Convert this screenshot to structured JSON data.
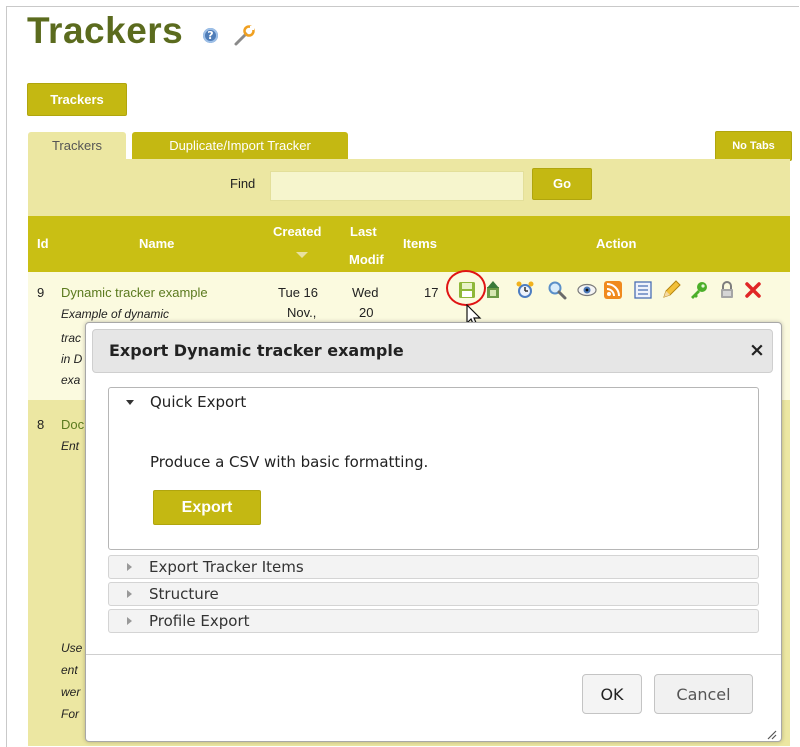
{
  "page": {
    "title": "Trackers",
    "help_icon": "help-icon",
    "admin_icon": "wrench-icon",
    "trackers_button": "Trackers",
    "no_tabs_button": "No Tabs"
  },
  "tabs": [
    {
      "label": "Trackers",
      "active": true
    },
    {
      "label": "Duplicate/Import Tracker",
      "active": false
    }
  ],
  "find": {
    "label": "Find",
    "value": "",
    "button": "Go"
  },
  "table": {
    "headers": {
      "id": "Id",
      "name": "Name",
      "created": "Created",
      "last_modif_line1": "Last",
      "last_modif_line2": "Modif",
      "items": "Items",
      "action": "Action"
    },
    "rows": [
      {
        "id": "9",
        "name": "Dynamic tracker example",
        "description_line1": "Example of dynamic",
        "description_partial": [
          "trac",
          "in D",
          "exa"
        ],
        "created_line1": "Tue 16",
        "created_line2": "Nov.,",
        "modified_line1": "Wed",
        "modified_line2": "20",
        "items": "17"
      },
      {
        "id": "8",
        "name_partial": "Doc",
        "description_partial": [
          "Ent",
          "Use",
          "ent",
          "wer",
          "For"
        ]
      }
    ],
    "action_icons": [
      "save-icon",
      "export-icon",
      "alarm-icon",
      "search-icon",
      "view-icon",
      "rss-icon",
      "list-icon",
      "edit-icon",
      "permissions-key-icon",
      "lock-icon",
      "delete-icon"
    ]
  },
  "dialog": {
    "title": "Export Dynamic tracker example",
    "close_label": "×",
    "sections": [
      {
        "label": "Quick Export",
        "expanded": true
      },
      {
        "label": "Export Tracker Items",
        "expanded": false
      },
      {
        "label": "Structure",
        "expanded": false
      },
      {
        "label": "Profile Export",
        "expanded": false
      }
    ],
    "quick_export_text": "Produce a CSV with basic formatting.",
    "export_button": "Export",
    "ok_button": "OK",
    "cancel_button": "Cancel"
  },
  "colors": {
    "accent": "#c4b812",
    "title_green": "#5b6b1e",
    "link_green": "#5b7a1e",
    "panel_bg": "#ece7a2",
    "highlight_red": "#e01414"
  }
}
